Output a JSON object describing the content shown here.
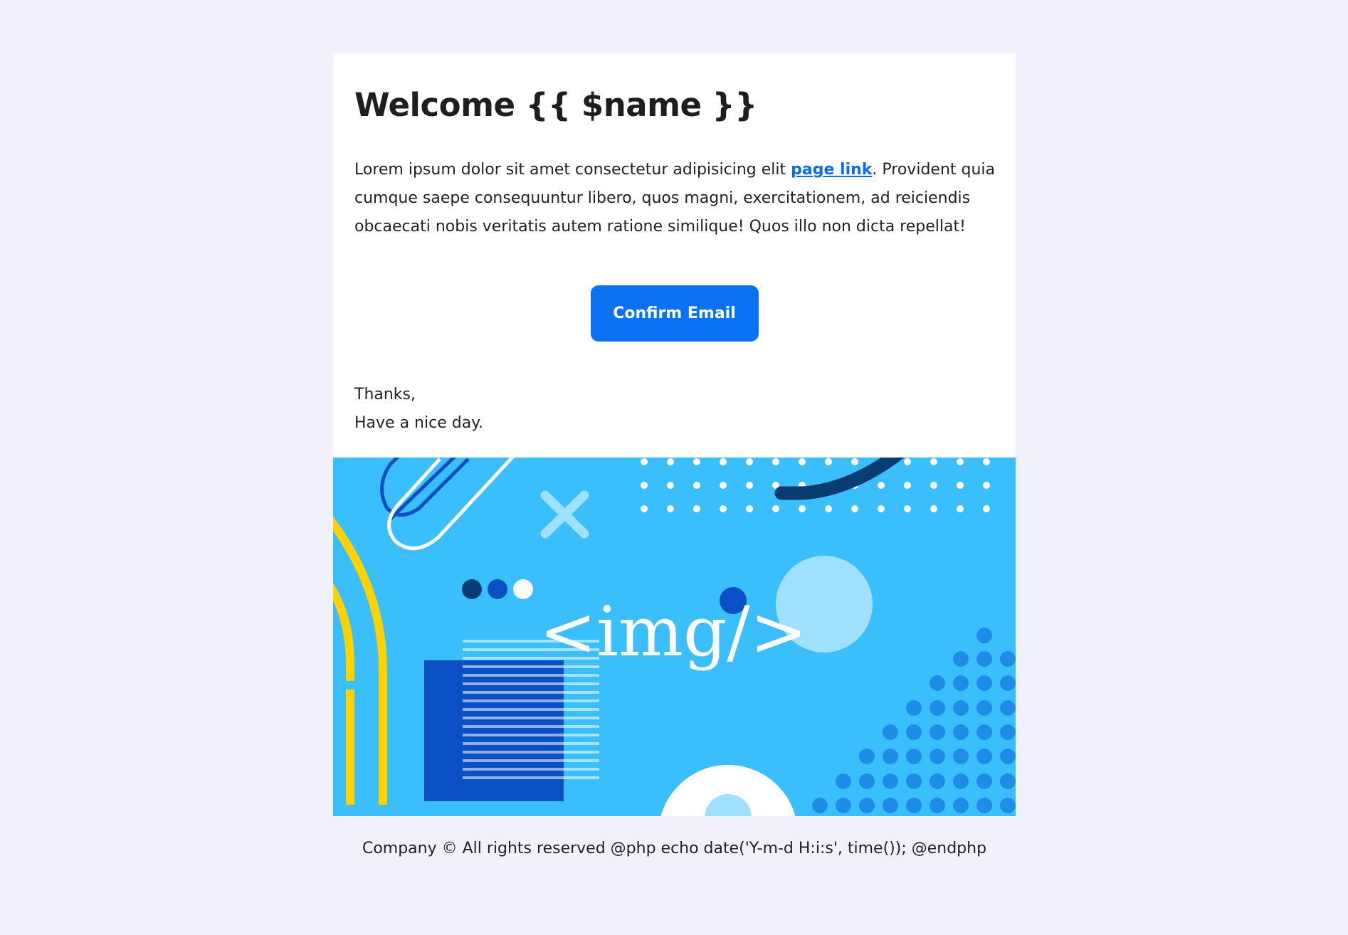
{
  "email": {
    "title": "Welcome {{ $name }}",
    "paragraph_before_link": "Lorem ipsum dolor sit amet consectetur adipisicing elit ",
    "link_text": "page link",
    "paragraph_after_link": ". Provident quia cumque saepe consequuntur libero, quos magni, exercitationem, ad reiciendis obcaecati nobis veritatis autem ratione similique! Quos illo non dicta repellat!",
    "button_label": "Confirm Email",
    "signoff_line1": "Thanks,",
    "signoff_line2": "Have a nice day."
  },
  "banner": {
    "placeholder_text": "<img/>"
  },
  "footer": {
    "text": "Company © All rights reserved @php echo date('Y-m-d H:i:s', time()); @endphp"
  },
  "colors": {
    "page_background": "#f0f1fb",
    "button": "#0b72f6",
    "link": "#0a6cf0",
    "banner_background": "#3bbffc"
  }
}
